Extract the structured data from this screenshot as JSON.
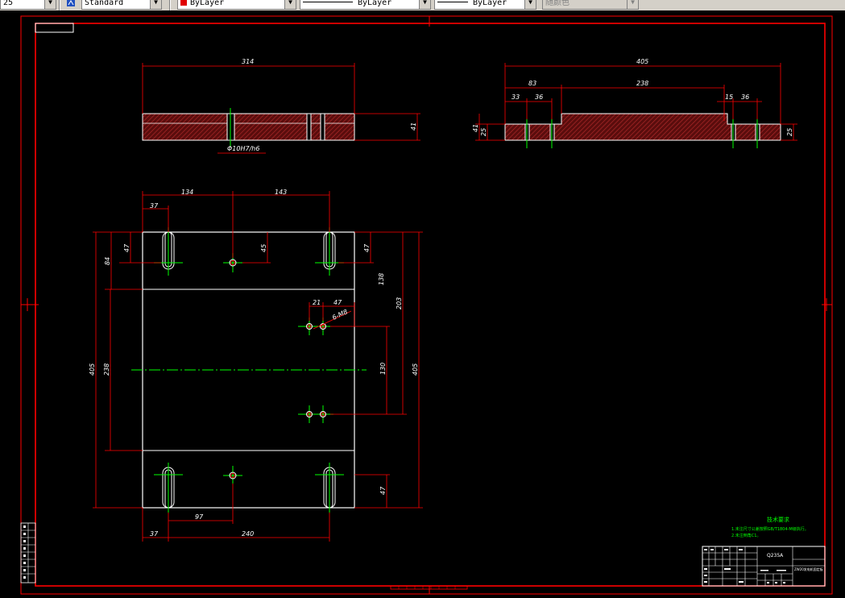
{
  "toolbar": {
    "scale_value": "25",
    "text_style": "Standard",
    "layer": "ByLayer",
    "linetype": "ByLayer",
    "lineweight": "ByLayer",
    "plot_style": "随颜色"
  },
  "top_view": {
    "width_dim": "314",
    "height_dim": "41",
    "hole_dim": "Φ10H7/h6"
  },
  "right_view": {
    "total_dim": "405",
    "dim_83": "83",
    "dim_238": "238",
    "dim_33": "33",
    "dim_36a": "36",
    "dim_15": "15",
    "dim_36b": "36",
    "dim_41": "41",
    "dim_25a": "25",
    "dim_25b": "25"
  },
  "plan_view": {
    "dim_134": "134",
    "dim_143": "143",
    "dim_37_top": "37",
    "dim_47_left": "47",
    "dim_84": "84",
    "dim_45": "45",
    "dim_47_right": "47",
    "dim_138": "138",
    "dim_203": "203",
    "dim_405_right": "405",
    "dim_21": "21",
    "dim_47_mid": "47",
    "hole_callout": "6-M8",
    "dim_130": "130",
    "dim_405_left": "405",
    "dim_238": "238",
    "dim_47_bottom": "47",
    "dim_97": "97",
    "dim_37_bottom": "37",
    "dim_240": "240"
  },
  "notes": {
    "heading": "技术要求",
    "line1": "1.未注尺寸公差按照GB/T1804-M级执行。",
    "line2": "2.未注倒角C1。"
  },
  "title_block": {
    "material": "Q235A",
    "drawing_name": "ZW20发电机固定板"
  },
  "colors": {
    "border": "#ff0000",
    "part_outline": "#ffffff",
    "centerline": "#00ff00",
    "hatch": "#8a1a1a",
    "dimension": "#ff0000",
    "notes": "#00ff00"
  }
}
